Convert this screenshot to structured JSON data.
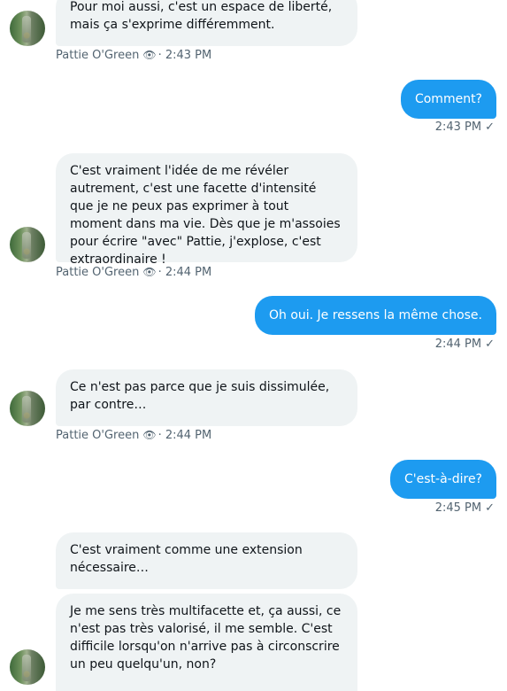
{
  "messages": {
    "m1": {
      "text": "Pour moi aussi, c'est un espace de liberté, mais ça s'exprime différemment.",
      "author": "Pattie O'Green",
      "time": "2:43 PM"
    },
    "m2": {
      "text": "Comment?",
      "time": "2:43 PM"
    },
    "m3": {
      "text": "C'est vraiment l'idée de me révéler autrement, c'est une facette d'intensité que je ne peux pas exprimer à tout moment dans ma vie. Dès que je m'assoies pour écrire \"avec\" Pattie, j'explose, c'est extraordinaire !",
      "author": "Pattie O'Green",
      "time": "2:44 PM"
    },
    "m4": {
      "text": "Oh oui. Je ressens la même chose.",
      "time": "2:44 PM"
    },
    "m5": {
      "text": "Ce n'est pas parce que je suis dissimulée, par contre…",
      "author": "Pattie O'Green",
      "time": "2:44 PM"
    },
    "m6": {
      "text": "C'est-à-dire?",
      "time": "2:45 PM"
    },
    "m7": {
      "text": "C'est vraiment comme une extension nécessaire…"
    },
    "m8": {
      "text": "Je me sens très multifacette et, ça aussi, ce n'est pas très valorisé, il me semble. C'est difficile lorsqu'on n'arrive pas à circonscrire un peu quelqu'un, non?"
    }
  },
  "meta": {
    "separator": "·",
    "seen_icon": "eye-icon",
    "delivered_icon": "checkmark-icon"
  },
  "colors": {
    "outgoing": "#1d9bf0",
    "incoming": "#eff3f4",
    "meta": "#536471"
  }
}
